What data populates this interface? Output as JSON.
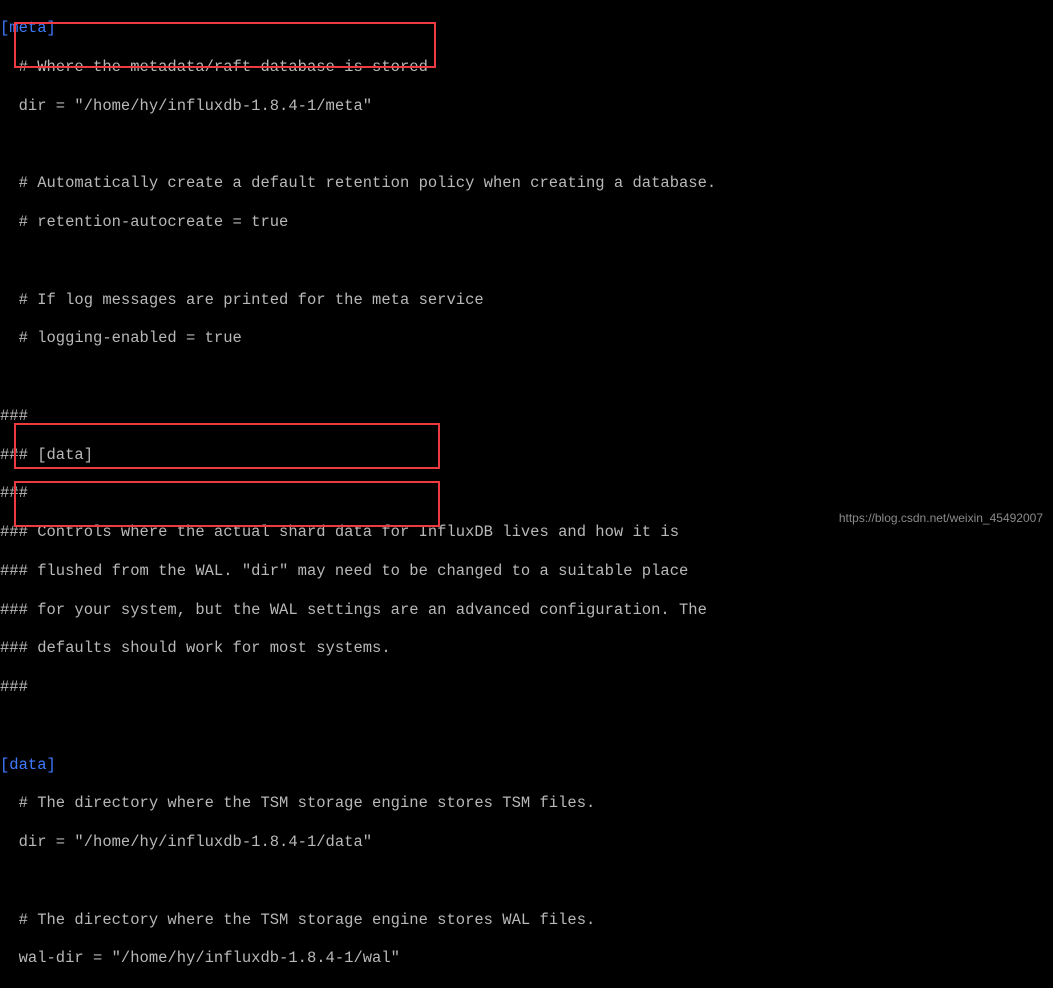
{
  "sections": {
    "meta_header": "[meta]",
    "meta_comment1": "  # Where the metadata/raft database is stored",
    "meta_dir": "  dir = \"/home/hy/influxdb-1.8.4-1/meta\"",
    "meta_comment2": "  # Automatically create a default retention policy when creating a database.",
    "meta_comment3": "  # retention-autocreate = true",
    "meta_comment4": "  # If log messages are printed for the meta service",
    "meta_comment5": "  # logging-enabled = true",
    "hash1": "###",
    "data_section_header": "### [data]",
    "hash2": "###",
    "data_desc1": "### Controls where the actual shard data for InfluxDB lives and how it is",
    "data_desc2": "### flushed from the WAL. \"dir\" may need to be changed to a suitable place",
    "data_desc3": "### for your system, but the WAL settings are an advanced configuration. The",
    "data_desc4": "### defaults should work for most systems.",
    "hash3": "###",
    "data_header": "[data]",
    "data_comment1": "  # The directory where the TSM storage engine stores TSM files.",
    "data_dir": "  dir = \"/home/hy/influxdb-1.8.4-1/data\"",
    "data_comment2": "  # The directory where the TSM storage engine stores WAL files.",
    "data_waldir": "  wal-dir = \"/home/hy/influxdb-1.8.4-1/wal\""
  },
  "watermark": "https://blog.csdn.net/weixin_45492007"
}
